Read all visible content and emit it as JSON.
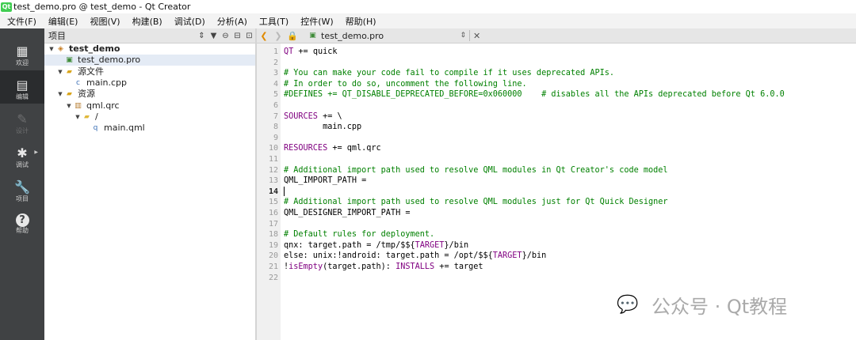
{
  "window": {
    "title": "test_demo.pro @ test_demo - Qt Creator",
    "logo": "qt-icon"
  },
  "menu": [
    "文件(F)",
    "编辑(E)",
    "视图(V)",
    "构建(B)",
    "调试(D)",
    "分析(A)",
    "工具(T)",
    "控件(W)",
    "帮助(H)"
  ],
  "modes": [
    {
      "label": "欢迎",
      "icon": "grid-icon",
      "active": false,
      "enabled": true
    },
    {
      "label": "编辑",
      "icon": "document-icon",
      "active": true,
      "enabled": true
    },
    {
      "label": "设计",
      "icon": "pencil-icon",
      "active": false,
      "enabled": false
    },
    {
      "label": "调试",
      "icon": "bug-icon",
      "active": false,
      "enabled": true
    },
    {
      "label": "项目",
      "icon": "wrench-icon",
      "active": false,
      "enabled": true
    },
    {
      "label": "帮助",
      "icon": "help-icon",
      "active": false,
      "enabled": true
    }
  ],
  "project_pane": {
    "title": "项目",
    "tree": [
      {
        "label": "test_demo",
        "icon": "qt-project-icon",
        "level": 0,
        "expanded": true,
        "bold": true
      },
      {
        "label": "test_demo.pro",
        "icon": "pro-file-icon",
        "level": 1,
        "selected": true
      },
      {
        "label": "源文件",
        "icon": "source-folder-icon",
        "level": 1,
        "expanded": true
      },
      {
        "label": "main.cpp",
        "icon": "cpp-file-icon",
        "level": 2
      },
      {
        "label": "资源",
        "icon": "resource-folder-icon",
        "level": 1,
        "expanded": true
      },
      {
        "label": "qml.qrc",
        "icon": "qrc-file-icon",
        "level": 2,
        "expanded": true
      },
      {
        "label": "/",
        "icon": "folder-icon",
        "level": 3,
        "expanded": true
      },
      {
        "label": "main.qml",
        "icon": "qml-file-icon",
        "level": 4
      }
    ]
  },
  "editor": {
    "file_name": "test_demo.pro",
    "current_line": 14,
    "lines": [
      [
        {
          "t": "QT",
          "c": "var"
        },
        {
          "t": " += quick",
          "c": ""
        }
      ],
      [],
      [
        {
          "t": "# You can make your code fail to compile if it uses deprecated APIs.",
          "c": "comment"
        }
      ],
      [
        {
          "t": "# In order to do so, uncomment the following line.",
          "c": "comment"
        }
      ],
      [
        {
          "t": "#DEFINES += QT_DISABLE_DEPRECATED_BEFORE=0x060000    # disables all the APIs deprecated before Qt 6.0.0",
          "c": "comment"
        }
      ],
      [],
      [
        {
          "t": "SOURCES",
          "c": "var"
        },
        {
          "t": " += \\",
          "c": ""
        }
      ],
      [
        {
          "t": "        main.cpp",
          "c": ""
        }
      ],
      [],
      [
        {
          "t": "RESOURCES",
          "c": "var"
        },
        {
          "t": " += qml.qrc",
          "c": ""
        }
      ],
      [],
      [
        {
          "t": "# Additional import path used to resolve QML modules in Qt Creator's code model",
          "c": "comment"
        }
      ],
      [
        {
          "t": "QML_IMPORT_PATH =",
          "c": ""
        }
      ],
      [],
      [
        {
          "t": "# Additional import path used to resolve QML modules just for Qt Quick Designer",
          "c": "comment"
        }
      ],
      [
        {
          "t": "QML_DESIGNER_IMPORT_PATH =",
          "c": ""
        }
      ],
      [],
      [
        {
          "t": "# Default rules for deployment.",
          "c": "comment"
        }
      ],
      [
        {
          "t": "qnx: target.path = /tmp/$${",
          "c": ""
        },
        {
          "t": "TARGET",
          "c": "var"
        },
        {
          "t": "}/bin",
          "c": ""
        }
      ],
      [
        {
          "t": "else: unix:!android: target.path = /opt/$${",
          "c": ""
        },
        {
          "t": "TARGET",
          "c": "var"
        },
        {
          "t": "}/bin",
          "c": ""
        }
      ],
      [
        {
          "t": "!",
          "c": ""
        },
        {
          "t": "isEmpty",
          "c": "var"
        },
        {
          "t": "(target.path): ",
          "c": ""
        },
        {
          "t": "INSTALLS",
          "c": "var"
        },
        {
          "t": " += target",
          "c": ""
        }
      ],
      []
    ]
  },
  "watermark": {
    "text": "公众号 · Qt教程",
    "icon": "wechat-icon"
  },
  "colors": {
    "comment": "#008000",
    "keyword": "#800080",
    "modebar": "#404244",
    "nav_arrow": "#e08a00"
  }
}
